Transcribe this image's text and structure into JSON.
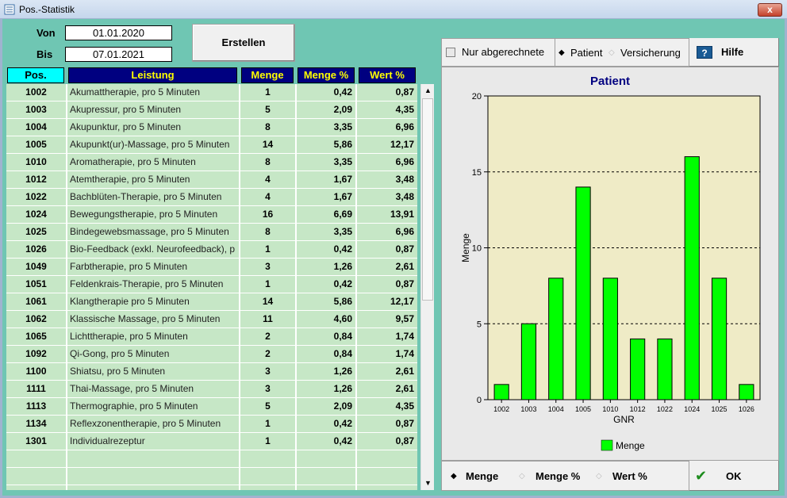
{
  "window": {
    "title": "Pos.-Statistik",
    "close_label": "x"
  },
  "filter": {
    "von_label": "Von",
    "von_value": "01.01.2020",
    "bis_label": "Bis",
    "bis_value": "07.01.2021",
    "create_label": "Erstellen"
  },
  "table": {
    "columns": [
      "Pos.",
      "Leistung",
      "Menge",
      "Menge %",
      "Wert %"
    ],
    "rows": [
      [
        "1002",
        "Akumattherapie, pro 5 Minuten",
        "1",
        "0,42",
        "0,87"
      ],
      [
        "1003",
        "Akupressur, pro 5 Minuten",
        "5",
        "2,09",
        "4,35"
      ],
      [
        "1004",
        "Akupunktur, pro 5 Minuten",
        "8",
        "3,35",
        "6,96"
      ],
      [
        "1005",
        "Akupunkt(ur)-Massage, pro 5 Minuten",
        "14",
        "5,86",
        "12,17"
      ],
      [
        "1010",
        "Aromatherapie, pro 5 Minuten",
        "8",
        "3,35",
        "6,96"
      ],
      [
        "1012",
        "Atemtherapie, pro 5 Minuten",
        "4",
        "1,67",
        "3,48"
      ],
      [
        "1022",
        "Bachblüten-Therapie, pro 5 Minuten",
        "4",
        "1,67",
        "3,48"
      ],
      [
        "1024",
        "Bewegungstherapie, pro 5 Minuten",
        "16",
        "6,69",
        "13,91"
      ],
      [
        "1025",
        "Bindegewebsmassage, pro 5 Minuten",
        "8",
        "3,35",
        "6,96"
      ],
      [
        "1026",
        "Bio-Feedback (exkl. Neurofeedback), p",
        "1",
        "0,42",
        "0,87"
      ],
      [
        "1049",
        "Farbtherapie, pro 5 Minuten",
        "3",
        "1,26",
        "2,61"
      ],
      [
        "1051",
        "Feldenkrais-Therapie, pro 5 Minuten",
        "1",
        "0,42",
        "0,87"
      ],
      [
        "1061",
        "Klangtherapie pro  5 Minuten",
        "14",
        "5,86",
        "12,17"
      ],
      [
        "1062",
        "Klassische Massage, pro 5 Minuten",
        "11",
        "4,60",
        "9,57"
      ],
      [
        "1065",
        "Lichttherapie, pro 5 Minuten",
        "2",
        "0,84",
        "1,74"
      ],
      [
        "1092",
        "Qi-Gong, pro 5 Minuten",
        "2",
        "0,84",
        "1,74"
      ],
      [
        "1100",
        "Shiatsu, pro 5 Minuten",
        "3",
        "1,26",
        "2,61"
      ],
      [
        "1111",
        "Thai-Massage, pro 5 Minuten",
        "3",
        "1,26",
        "2,61"
      ],
      [
        "1113",
        "Thermographie, pro 5 Minuten",
        "5",
        "2,09",
        "4,35"
      ],
      [
        "1134",
        "Reflexzonentherapie, pro 5 Minuten",
        "1",
        "0,42",
        "0,87"
      ],
      [
        "1301",
        "Individualrezeptur",
        "1",
        "0,42",
        "0,87"
      ],
      [
        "",
        "",
        "",
        "",
        ""
      ],
      [
        "",
        "",
        "",
        "",
        ""
      ]
    ]
  },
  "options": {
    "nur_abgerechnete": "Nur abgerechnete",
    "patient": "Patient",
    "versicherung": "Versicherung",
    "hilfe": "Hilfe",
    "help_icon": "?"
  },
  "bottom": {
    "menge": "Menge",
    "menge_pct": "Menge %",
    "wert_pct": "Wert %",
    "ok": "OK"
  },
  "colors": {
    "bar": "#00ff00",
    "plot_bg": "#efebc6",
    "title": "#000080"
  },
  "chart_data": {
    "type": "bar",
    "title": "Patient",
    "xlabel": "GNR",
    "ylabel": "Menge",
    "categories": [
      "1002",
      "1003",
      "1004",
      "1005",
      "1010",
      "1012",
      "1022",
      "1024",
      "1025",
      "1026"
    ],
    "series": [
      {
        "name": "Menge",
        "values": [
          1,
          5,
          8,
          14,
          8,
          4,
          4,
          16,
          8,
          1
        ]
      }
    ],
    "ylim": [
      0,
      20
    ],
    "yticks": [
      0,
      5,
      10,
      15,
      20
    ],
    "legend": "bottom",
    "grid": "horizontal-dashed"
  }
}
